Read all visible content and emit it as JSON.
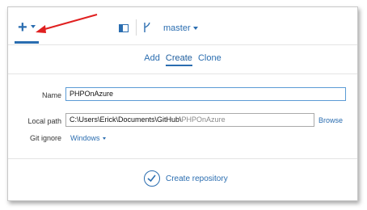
{
  "toolbar": {
    "add_icon": "plus-icon",
    "panel_icon": "panel-icon",
    "branch_icon": "branch-icon",
    "branch_name": "master"
  },
  "tabs": [
    {
      "label": "Add",
      "active": false
    },
    {
      "label": "Create",
      "active": true
    },
    {
      "label": "Clone",
      "active": false
    }
  ],
  "form": {
    "name_label": "Name",
    "name_value": "PHPOnAzure",
    "local_path_label": "Local path",
    "local_path_prefix": "C:\\Users\\Erick\\Documents\\GitHub\\",
    "local_path_suffix": "PHPOnAzure",
    "browse_label": "Browse",
    "git_ignore_label": "Git ignore",
    "git_ignore_value": "Windows"
  },
  "create_button": {
    "label": "Create repository",
    "icon": "check-icon"
  },
  "colors": {
    "accent": "#2a6db0",
    "annotation_arrow": "#e02020"
  }
}
